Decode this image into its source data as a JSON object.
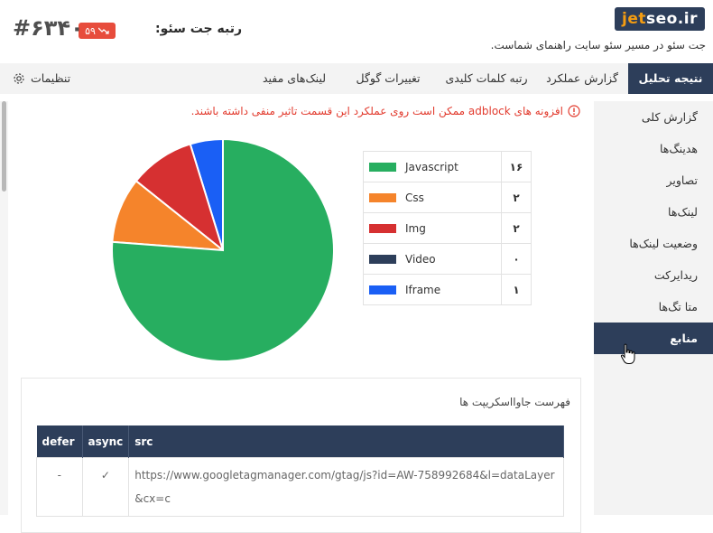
{
  "header": {
    "logo_part1": "jet",
    "logo_part2": "seo.ir",
    "tagline": "جت سئو در مسیر سئو سایت راهنمای شماست.",
    "rank_title": "رتبه جت سئو:",
    "rank_badge": "۵۹",
    "rank_value": "#۶۳۴۰"
  },
  "tabs": [
    {
      "label": "نتیجه تحلیل",
      "active": true
    },
    {
      "label": "گزارش عملکرد",
      "active": false
    },
    {
      "label": "رتبه کلمات کلیدی",
      "active": false
    },
    {
      "label": "تغییرات گوگل",
      "active": false
    },
    {
      "label": "لینک‌های مفید",
      "active": false
    }
  ],
  "settings_label": "تنظیمات",
  "sidebar": {
    "items": [
      {
        "label": "گزارش کلی",
        "active": false
      },
      {
        "label": "هدینگ‌ها",
        "active": false
      },
      {
        "label": "تصاویر",
        "active": false
      },
      {
        "label": "لینک‌ها",
        "active": false
      },
      {
        "label": "وضعیت لینک‌ها",
        "active": false
      },
      {
        "label": "ریدایرکت",
        "active": false
      },
      {
        "label": "متا تگ‌ها",
        "active": false
      },
      {
        "label": "منابع",
        "active": true
      }
    ]
  },
  "warning": "افزونه های adblock ممکن است روی عملکرد این قسمت تاثیر منفی داشته باشند.",
  "colors": {
    "primary": "#2d3e5a",
    "brand_orange": "#f39c12",
    "warning": "#e23b2e",
    "badge": "#e74c3c"
  },
  "chart_data": {
    "type": "pie",
    "title": "",
    "series": [
      {
        "name": "Javascript",
        "value": 16,
        "value_label": "۱۶",
        "color": "#27ae60"
      },
      {
        "name": "Css",
        "value": 2,
        "value_label": "۲",
        "color": "#f5842b"
      },
      {
        "name": "Img",
        "value": 2,
        "value_label": "۲",
        "color": "#d63031"
      },
      {
        "name": "Video",
        "value": 0,
        "value_label": "۰",
        "color": "#2d3e5a"
      },
      {
        "name": "Iframe",
        "value": 1,
        "value_label": "۱",
        "color": "#1a5ff5"
      }
    ],
    "legend": "right"
  },
  "js_list": {
    "title": "فهرست جاوااسکریپت ها",
    "columns": [
      "defer",
      "async",
      "src"
    ],
    "rows": [
      {
        "defer": "-",
        "async": "✓",
        "src": "https://www.googletagmanager.com/gtag/js?id=AW-758992684&l=dataLayer&cx=c"
      }
    ]
  }
}
